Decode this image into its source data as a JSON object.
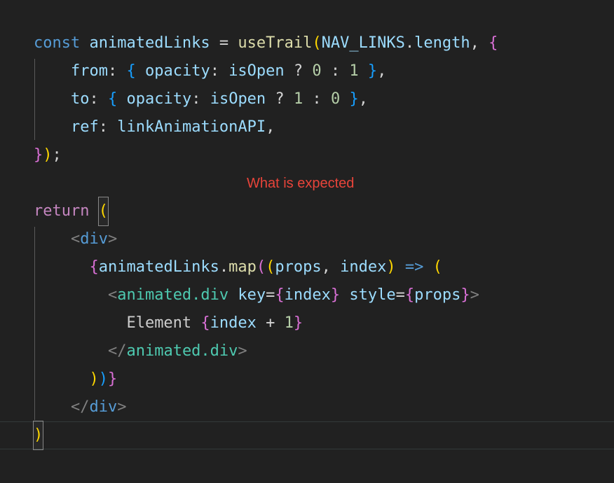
{
  "editor": {
    "background": "#212121",
    "default_text_color": "#d4d4d4",
    "font_size_px": 22,
    "line_height_px": 40,
    "language": "jsx"
  },
  "annotation": {
    "text": "What is expected",
    "color": "#e8443a"
  },
  "colors": {
    "keyword": "#569cd6",
    "control_keyword": "#c586c0",
    "variable": "#9cdcfe",
    "function": "#dcdcaa",
    "number": "#b5cea8",
    "plain": "#d4d4d4",
    "text": "#cccccc",
    "tag_punct": "#808080",
    "class_name": "#4ec9b0",
    "bracket_level_1": "#ffd700",
    "bracket_level_2": "#da70d6",
    "bracket_level_3": "#179fff",
    "indent_guide": "#5a5a5a",
    "bracket_match_border": "#888888"
  },
  "code": {
    "plain_text": "const animatedLinks = useTrail(NAV_LINKS.length, {\n    from: { opacity: isOpen ? 0 : 1 },\n    to: { opacity: isOpen ? 1 : 0 },\n    ref: linkAnimationAPI,\n});\n\nreturn (\n    <div>\n      {animatedLinks.map((props, index) => (\n        <animated.div key={index} style={props}>\n          Element {index + 1}\n        </animated.div>\n      ))}\n    </div>\n)",
    "lines": [
      {
        "indent": 0,
        "tokens": [
          {
            "text": "const",
            "cls": "t-keyword"
          },
          {
            "text": " ",
            "cls": "t-plain"
          },
          {
            "text": "animatedLinks",
            "cls": "t-var"
          },
          {
            "text": " = ",
            "cls": "t-plain"
          },
          {
            "text": "useTrail",
            "cls": "t-func"
          },
          {
            "text": "(",
            "cls": "t-b1"
          },
          {
            "text": "NAV_LINKS",
            "cls": "t-var"
          },
          {
            "text": ".",
            "cls": "t-plain"
          },
          {
            "text": "length",
            "cls": "t-var"
          },
          {
            "text": ", ",
            "cls": "t-plain"
          },
          {
            "text": "{",
            "cls": "t-b2"
          }
        ]
      },
      {
        "indent": 1,
        "tokens": [
          {
            "text": "    ",
            "cls": "t-plain"
          },
          {
            "text": "from",
            "cls": "t-var"
          },
          {
            "text": ": ",
            "cls": "t-plain"
          },
          {
            "text": "{",
            "cls": "t-b3"
          },
          {
            "text": " ",
            "cls": "t-plain"
          },
          {
            "text": "opacity",
            "cls": "t-var"
          },
          {
            "text": ": ",
            "cls": "t-plain"
          },
          {
            "text": "isOpen",
            "cls": "t-var"
          },
          {
            "text": " ? ",
            "cls": "t-plain"
          },
          {
            "text": "0",
            "cls": "t-num"
          },
          {
            "text": " : ",
            "cls": "t-plain"
          },
          {
            "text": "1",
            "cls": "t-num"
          },
          {
            "text": " ",
            "cls": "t-plain"
          },
          {
            "text": "}",
            "cls": "t-b3"
          },
          {
            "text": ",",
            "cls": "t-plain"
          }
        ]
      },
      {
        "indent": 1,
        "tokens": [
          {
            "text": "    ",
            "cls": "t-plain"
          },
          {
            "text": "to",
            "cls": "t-var"
          },
          {
            "text": ": ",
            "cls": "t-plain"
          },
          {
            "text": "{",
            "cls": "t-b3"
          },
          {
            "text": " ",
            "cls": "t-plain"
          },
          {
            "text": "opacity",
            "cls": "t-var"
          },
          {
            "text": ": ",
            "cls": "t-plain"
          },
          {
            "text": "isOpen",
            "cls": "t-var"
          },
          {
            "text": " ? ",
            "cls": "t-plain"
          },
          {
            "text": "1",
            "cls": "t-num"
          },
          {
            "text": " : ",
            "cls": "t-plain"
          },
          {
            "text": "0",
            "cls": "t-num"
          },
          {
            "text": " ",
            "cls": "t-plain"
          },
          {
            "text": "}",
            "cls": "t-b3"
          },
          {
            "text": ",",
            "cls": "t-plain"
          }
        ]
      },
      {
        "indent": 1,
        "tokens": [
          {
            "text": "    ",
            "cls": "t-plain"
          },
          {
            "text": "ref",
            "cls": "t-var"
          },
          {
            "text": ": ",
            "cls": "t-plain"
          },
          {
            "text": "linkAnimationAPI",
            "cls": "t-var"
          },
          {
            "text": ",",
            "cls": "t-plain"
          }
        ]
      },
      {
        "indent": 0,
        "tokens": [
          {
            "text": "}",
            "cls": "t-b2"
          },
          {
            "text": ")",
            "cls": "t-b1"
          },
          {
            "text": ";",
            "cls": "t-plain"
          }
        ]
      },
      {
        "indent": 0,
        "tokens": []
      },
      {
        "indent": 0,
        "tokens": [
          {
            "text": "return",
            "cls": "t-control"
          },
          {
            "text": " ",
            "cls": "t-plain"
          },
          {
            "text": "(",
            "cls": "t-b1",
            "match": true
          }
        ]
      },
      {
        "indent": 1,
        "tokens": [
          {
            "text": "    ",
            "cls": "t-plain"
          },
          {
            "text": "<",
            "cls": "t-tagpunct"
          },
          {
            "text": "div",
            "cls": "t-keyword"
          },
          {
            "text": ">",
            "cls": "t-tagpunct"
          }
        ]
      },
      {
        "indent": 1,
        "tokens": [
          {
            "text": "      ",
            "cls": "t-plain"
          },
          {
            "text": "{",
            "cls": "t-b2"
          },
          {
            "text": "animatedLinks",
            "cls": "t-var"
          },
          {
            "text": ".",
            "cls": "t-plain"
          },
          {
            "text": "map",
            "cls": "t-func"
          },
          {
            "text": "(",
            "cls": "t-b2"
          },
          {
            "text": "(",
            "cls": "t-b1"
          },
          {
            "text": "props",
            "cls": "t-var"
          },
          {
            "text": ", ",
            "cls": "t-plain"
          },
          {
            "text": "index",
            "cls": "t-var"
          },
          {
            "text": ")",
            "cls": "t-b1"
          },
          {
            "text": " ",
            "cls": "t-plain"
          },
          {
            "text": "=>",
            "cls": "t-keyword"
          },
          {
            "text": " ",
            "cls": "t-plain"
          },
          {
            "text": "(",
            "cls": "t-b1"
          }
        ]
      },
      {
        "indent": 2,
        "tokens": [
          {
            "text": "        ",
            "cls": "t-plain"
          },
          {
            "text": "<",
            "cls": "t-tagpunct"
          },
          {
            "text": "animated.div",
            "cls": "t-class"
          },
          {
            "text": " ",
            "cls": "t-plain"
          },
          {
            "text": "key",
            "cls": "t-var"
          },
          {
            "text": "=",
            "cls": "t-plain"
          },
          {
            "text": "{",
            "cls": "t-b2"
          },
          {
            "text": "index",
            "cls": "t-var"
          },
          {
            "text": "}",
            "cls": "t-b2"
          },
          {
            "text": " ",
            "cls": "t-plain"
          },
          {
            "text": "style",
            "cls": "t-var"
          },
          {
            "text": "=",
            "cls": "t-plain"
          },
          {
            "text": "{",
            "cls": "t-b2"
          },
          {
            "text": "props",
            "cls": "t-var"
          },
          {
            "text": "}",
            "cls": "t-b2"
          },
          {
            "text": ">",
            "cls": "t-tagpunct"
          }
        ]
      },
      {
        "indent": 2,
        "tokens": [
          {
            "text": "          ",
            "cls": "t-plain"
          },
          {
            "text": "Element ",
            "cls": "t-text"
          },
          {
            "text": "{",
            "cls": "t-b2"
          },
          {
            "text": "index",
            "cls": "t-var"
          },
          {
            "text": " + ",
            "cls": "t-plain"
          },
          {
            "text": "1",
            "cls": "t-num"
          },
          {
            "text": "}",
            "cls": "t-b2"
          }
        ]
      },
      {
        "indent": 2,
        "tokens": [
          {
            "text": "        ",
            "cls": "t-plain"
          },
          {
            "text": "</",
            "cls": "t-tagpunct"
          },
          {
            "text": "animated.div",
            "cls": "t-class"
          },
          {
            "text": ">",
            "cls": "t-tagpunct"
          }
        ]
      },
      {
        "indent": 1,
        "tokens": [
          {
            "text": "      ",
            "cls": "t-plain"
          },
          {
            "text": ")",
            "cls": "t-b1"
          },
          {
            "text": ")",
            "cls": "t-b3"
          },
          {
            "text": "}",
            "cls": "t-b2"
          }
        ]
      },
      {
        "indent": 1,
        "tokens": [
          {
            "text": "    ",
            "cls": "t-plain"
          },
          {
            "text": "</",
            "cls": "t-tagpunct"
          },
          {
            "text": "div",
            "cls": "t-keyword"
          },
          {
            "text": ">",
            "cls": "t-tagpunct"
          }
        ]
      },
      {
        "indent": 0,
        "current": true,
        "tokens": [
          {
            "text": ")",
            "cls": "t-b1",
            "match": true
          }
        ]
      }
    ]
  }
}
